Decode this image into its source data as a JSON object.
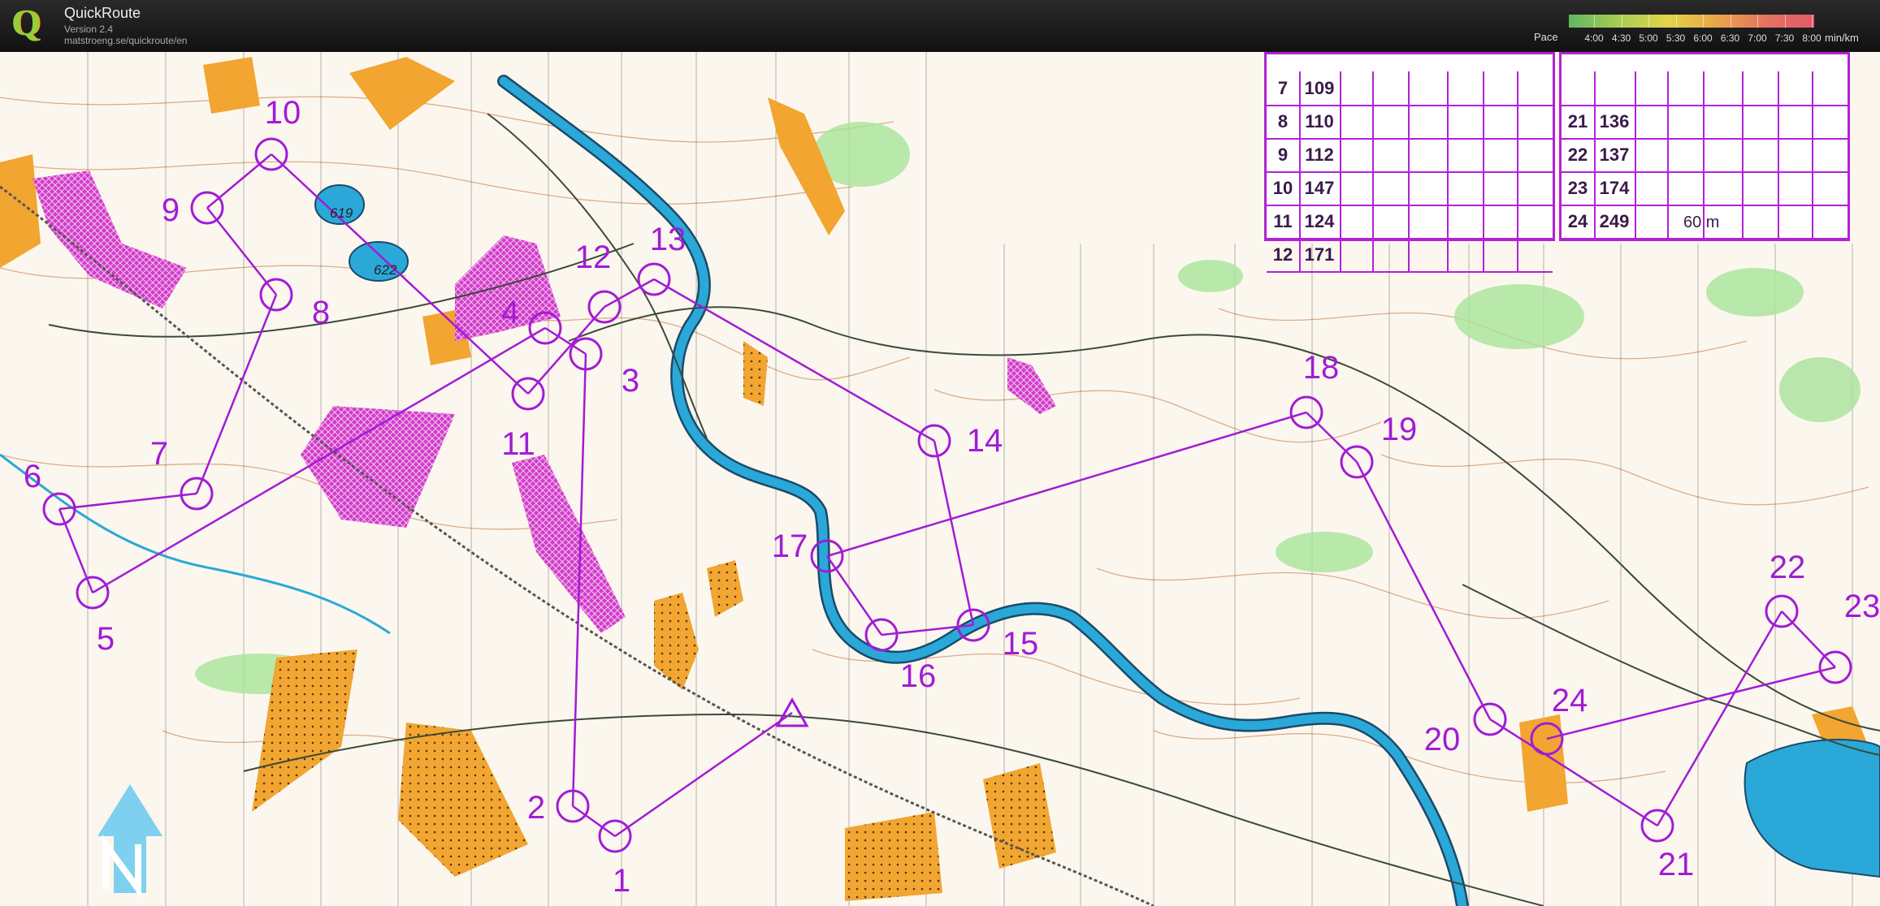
{
  "app": {
    "title": "QuickRoute",
    "version": "Version 2.4",
    "url": "matstroeng.se/quickroute/en"
  },
  "pace_legend": {
    "label": "Pace",
    "ticks": [
      "4:00",
      "4:30",
      "5:00",
      "5:30",
      "6:00",
      "6:30",
      "7:00",
      "7:30",
      "8:00"
    ],
    "unit": "min/km"
  },
  "map": {
    "controls": [
      {
        "id": "1",
        "label": "1"
      },
      {
        "id": "2",
        "label": "2"
      },
      {
        "id": "3",
        "label": "3"
      },
      {
        "id": "4",
        "label": "4"
      },
      {
        "id": "5",
        "label": "5"
      },
      {
        "id": "6",
        "label": "6"
      },
      {
        "id": "7",
        "label": "7"
      },
      {
        "id": "8",
        "label": "8"
      },
      {
        "id": "9",
        "label": "9"
      },
      {
        "id": "10",
        "label": "10"
      },
      {
        "id": "11",
        "label": "11"
      },
      {
        "id": "12",
        "label": "12"
      },
      {
        "id": "13",
        "label": "13"
      },
      {
        "id": "14",
        "label": "14"
      },
      {
        "id": "15",
        "label": "15"
      },
      {
        "id": "16",
        "label": "16"
      },
      {
        "id": "17",
        "label": "17"
      },
      {
        "id": "18",
        "label": "18"
      },
      {
        "id": "19",
        "label": "19"
      },
      {
        "id": "20",
        "label": "20"
      },
      {
        "id": "21",
        "label": "21"
      },
      {
        "id": "22",
        "label": "22"
      },
      {
        "id": "23",
        "label": "23"
      },
      {
        "id": "24",
        "label": "24"
      }
    ],
    "spot_heights": [
      "619",
      "622"
    ],
    "start_label": "",
    "colors": {
      "course": "#a21bd6",
      "water": "#2aa8d8",
      "open_land": "#f2a531",
      "forest_green": "#a9e39a",
      "contour": "#b8622a",
      "background": "#fbf7ee"
    }
  },
  "control_descriptions": {
    "left": [
      {
        "num": "7",
        "code": "109"
      },
      {
        "num": "8",
        "code": "110"
      },
      {
        "num": "9",
        "code": "112"
      },
      {
        "num": "10",
        "code": "147"
      },
      {
        "num": "11",
        "code": "124"
      },
      {
        "num": "12",
        "code": "171"
      }
    ],
    "right": [
      {
        "num": "",
        "code": ""
      },
      {
        "num": "21",
        "code": "136"
      },
      {
        "num": "22",
        "code": "137"
      },
      {
        "num": "23",
        "code": "174"
      },
      {
        "num": "24",
        "code": "249"
      }
    ],
    "finish_distance": "60 m"
  }
}
